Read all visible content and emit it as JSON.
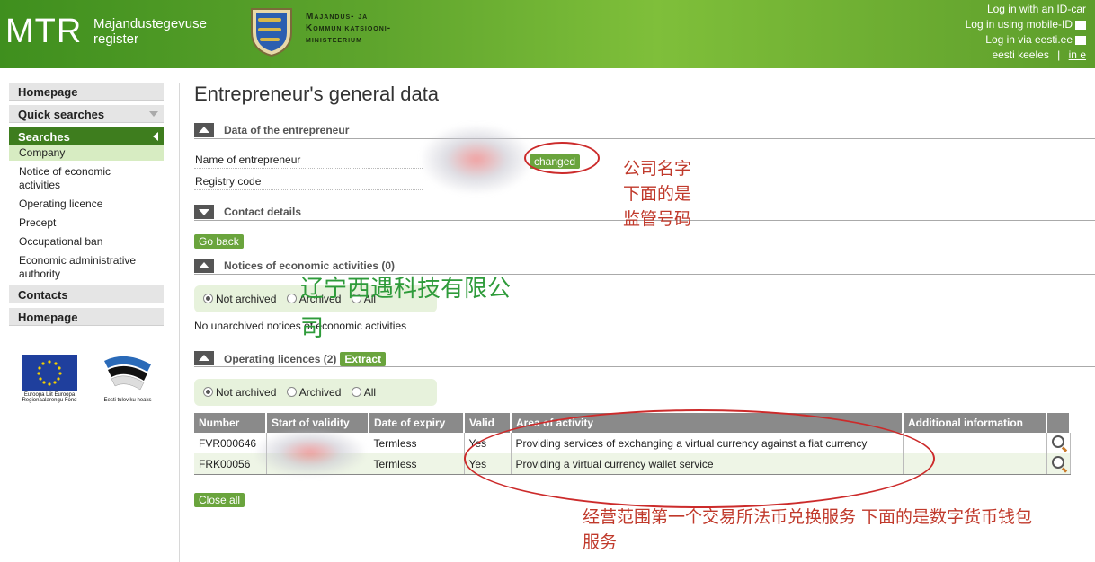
{
  "header": {
    "logo_text": "MTR",
    "logo_subtitle": "Majandustegevuse register",
    "ministry": "Majandus- ja Kommunikatsiooni- ministeerium",
    "login_id_card": "Log in with an ID-car",
    "login_mobile": "Log in using mobile-ID",
    "login_eesti": "Log in via eesti.ee",
    "lang_et": "eesti keeles",
    "lang_sep": "|",
    "lang_other": "in e"
  },
  "sidebar": {
    "homepage_top": "Homepage",
    "quick_searches": "Quick searches",
    "searches": "Searches",
    "sub_items": [
      "Company",
      "Notice of economic activities",
      "Operating licence",
      "Precept",
      "Occupational ban",
      "Economic administrative authority"
    ],
    "contacts": "Contacts",
    "homepage_bottom": "Homepage",
    "eu_logo_text": "Euroopa Liit Euroopa Regionaalarengu Fond",
    "ee_logo_text": "Eesti tuleviku heaks"
  },
  "main": {
    "title": "Entrepreneur's general data",
    "section_entrepreneur": "Data of the entrepreneur",
    "name_label": "Name of entrepreneur",
    "changed_badge": "changed",
    "registry_label": "Registry code",
    "section_contacts": "Contact details",
    "go_back": "Go back",
    "section_notices": "Notices of economic activities (0)",
    "filter_not_archived": "Not archived",
    "filter_archived": "Archived",
    "filter_all": "All",
    "no_notices": "No unarchived notices of economic activities",
    "section_licences": "Operating licences (2)",
    "extract": "Extract",
    "close_all": "Close all"
  },
  "table": {
    "headers": [
      "Number",
      "Start of validity",
      "Date of expiry",
      "Valid",
      "Area of activity",
      "Additional information"
    ],
    "rows": [
      {
        "number": "FVR000646",
        "expiry": "Termless",
        "valid": "Yes",
        "area": "Providing services of exchanging a virtual currency against a fiat currency",
        "info": ""
      },
      {
        "number": "FRK00056",
        "expiry": "Termless",
        "valid": "Yes",
        "area": "Providing a virtual currency wallet service",
        "info": ""
      }
    ]
  },
  "annotations": {
    "name_note_1": "公司名字",
    "name_note_2": "下面的是",
    "name_note_3": "监管号码",
    "company_name_1": "辽宁西遇科技有限公",
    "company_name_2": "司",
    "activity_note_1": "经营范围第一个交易所法币兑换服务 下面的是数字货币钱包",
    "activity_note_2": "服务"
  },
  "colors": {
    "header_green": "#5fa52d",
    "active_menu": "#3e7d1e",
    "button_green": "#6aa43d",
    "annotation_red": "#cc2b2b",
    "annotation_green": "#2e9b3a"
  }
}
